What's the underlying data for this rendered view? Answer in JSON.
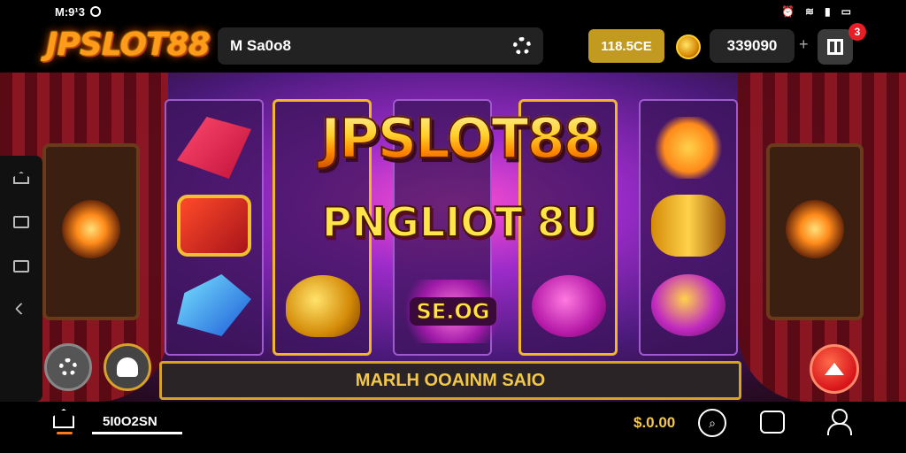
{
  "status_bar": {
    "time": "M:9¹3",
    "icons": [
      "alarm-icon",
      "wifi-icon",
      "signal-icon",
      "battery-icon"
    ]
  },
  "header": {
    "logo": "JPSLOT88",
    "search_value": "M Sa0o8",
    "coin_pill": "118.5CE",
    "balance": "339090",
    "plus": "+",
    "notification_count": "3"
  },
  "game": {
    "title_main": "JPSLOT88",
    "title_sub": "PNGLIOT 8U",
    "wild_label": "SE.OG",
    "banner": "MARLH OOAINM SAIO",
    "symbols": [
      "wing-arrow",
      "red-chest",
      "blue-gem",
      "gold-pot",
      "star-sword",
      "gold-drum",
      "pink-bowl",
      "feather-medallion"
    ]
  },
  "bottom_bar": {
    "label": "5I0O2SN",
    "bet": "$.0.00"
  },
  "colors": {
    "accent_gold": "#d6a22a",
    "spin_red": "#d8141a",
    "badge_red": "#e61e26",
    "coin_pill": "#c19a1f"
  }
}
